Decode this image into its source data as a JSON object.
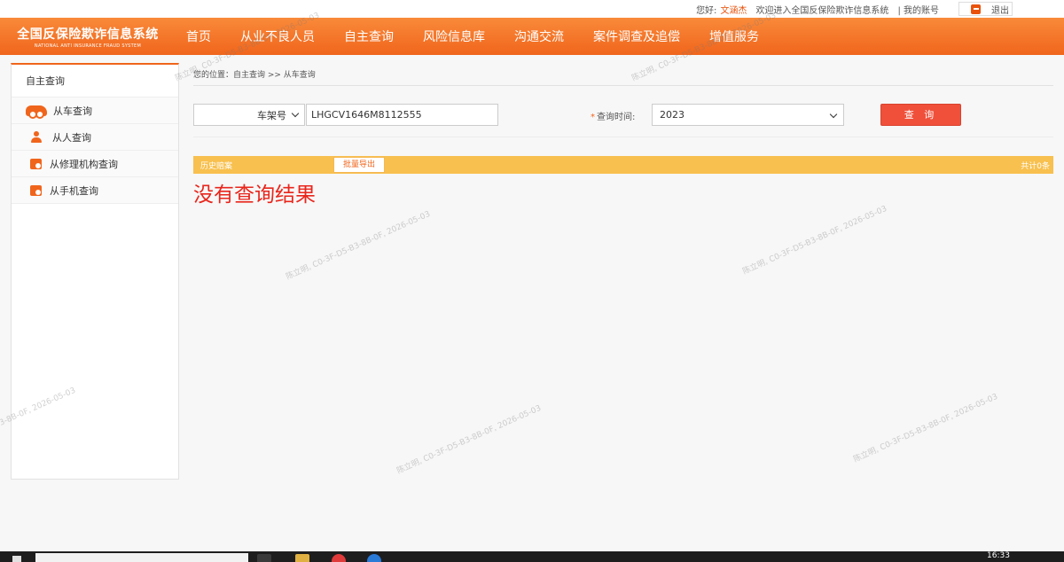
{
  "topbar": {
    "greeting": "您好:",
    "username": "文涵杰",
    "welcome": "欢迎进入全国反保险欺诈信息系统",
    "my_account": "| 我的账号",
    "logout": "退出"
  },
  "logo": {
    "title": "全国反保险欺诈信息系统",
    "subtitle": "NATIONAL ANTI INSURANCE FRAUD SYSTEM"
  },
  "nav": {
    "items": [
      "首页",
      "从业不良人员",
      "自主查询",
      "风险信息库",
      "沟通交流",
      "案件调查及追偿",
      "增值服务"
    ]
  },
  "sidebar": {
    "title": "自主查询",
    "items": [
      {
        "label": "从车查询",
        "icon": "car-icon"
      },
      {
        "label": "从人查询",
        "icon": "person-icon"
      },
      {
        "label": "从修理机构查询",
        "icon": "repair-shop-icon"
      },
      {
        "label": "从手机查询",
        "icon": "phone-shop-icon"
      }
    ]
  },
  "breadcrumb": "您的位置：自主查询 >> 从车查询",
  "query": {
    "type_selected": "车架号",
    "plate_value": "LHGCV1646M8112555",
    "time_label": "查询时间:",
    "year_selected": "2023",
    "query_button": "查 询"
  },
  "result": {
    "history_label": "历史赔案",
    "export_button": "批量导出",
    "total": "共计0条",
    "empty_message": "没有查询结果"
  },
  "watermark": "陈立明, C0-3F-D5-B3-8B-0F, 2026-05-03",
  "taskbar": {
    "time": "16:33"
  },
  "colors": {
    "brand_orange": "#f0651c",
    "result_bar": "#f8c04e",
    "query_button": "#f0503a",
    "no_result": "#e8261c"
  }
}
